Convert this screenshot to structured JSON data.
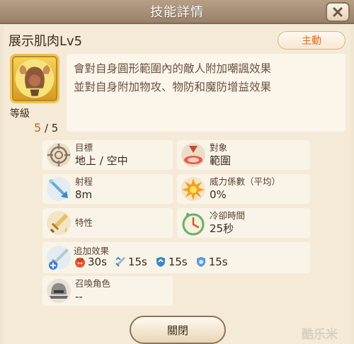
{
  "window": {
    "title": "技能詳情"
  },
  "skill": {
    "name": "展示肌肉Lv5",
    "type_badge": "主動",
    "level_label": "等級",
    "level_current": "5",
    "level_max": "/ 5",
    "description": [
      "會對自身圓形範圍內的敵人附加嘲諷效果",
      "並對自身附加物攻、物防和魔防增益效果"
    ]
  },
  "attributes": {
    "target": {
      "label": "目標",
      "value": "地上 / 空中",
      "icon": "crosshair-icon"
    },
    "area": {
      "label": "對象",
      "value": "範圍",
      "icon": "area-target-icon"
    },
    "range": {
      "label": "射程",
      "value": "8m",
      "icon": "range-arrow-icon"
    },
    "power": {
      "label": "威力係數（平均）",
      "value": "0%",
      "icon": "explosion-icon"
    },
    "trait": {
      "label": "特性",
      "value": "",
      "icon": "sword-icon"
    },
    "cooldown": {
      "label": "冷卻時間",
      "value": "25秒",
      "icon": "clock-icon"
    },
    "summon": {
      "label": "召喚角色",
      "value": "--",
      "icon": "helmet-icon"
    }
  },
  "additional_effects": {
    "label": "追加效果",
    "effects": [
      {
        "icon": "taunt-icon",
        "duration": "30s",
        "color": "#e8542a"
      },
      {
        "icon": "attack-up-icon",
        "duration": "15s",
        "color": "#4a9fd8"
      },
      {
        "icon": "defense-up-icon",
        "duration": "15s",
        "color": "#3a86c8"
      },
      {
        "icon": "magic-defense-up-icon",
        "duration": "15s",
        "color": "#3a7cc8"
      }
    ]
  },
  "buttons": {
    "close": "關閉"
  },
  "watermark": "酷乐米"
}
